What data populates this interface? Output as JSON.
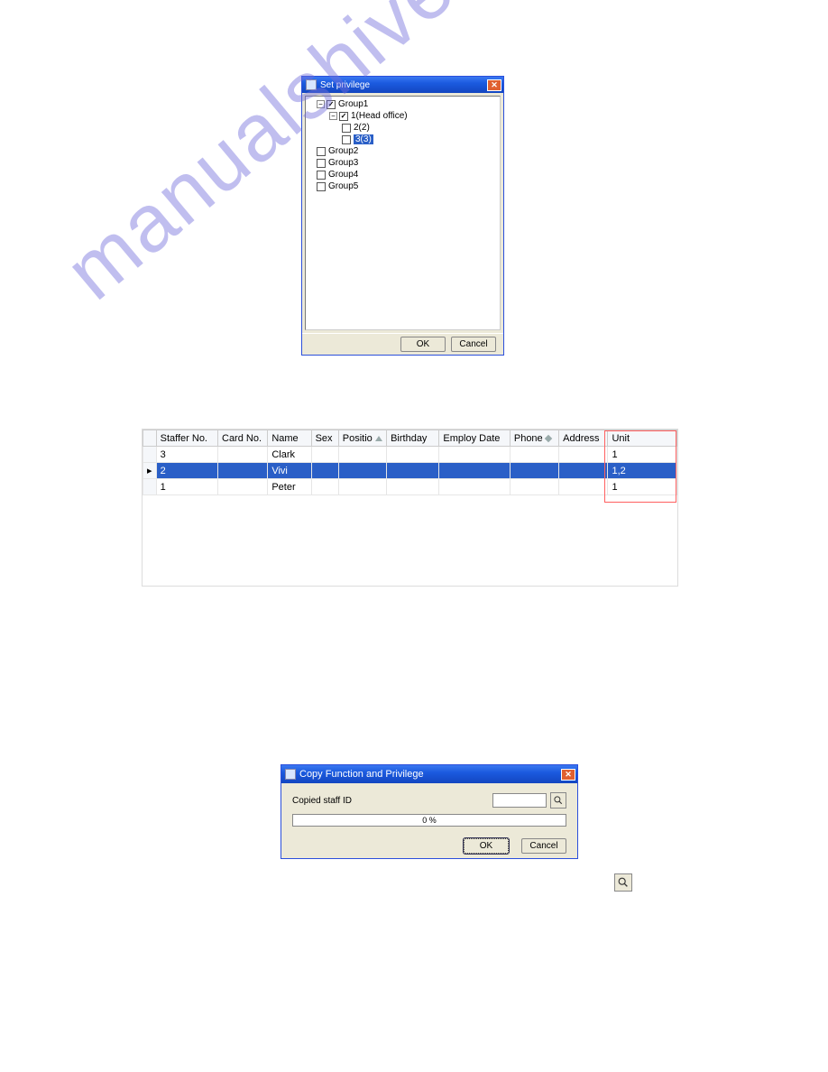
{
  "watermark": "manualshive.com",
  "dialog1": {
    "title": "Set privilege",
    "ok": "OK",
    "cancel": "Cancel",
    "tree": {
      "group1": "Group1",
      "item1": "1(Head office)",
      "item2": "2(2)",
      "item3": "3(3)",
      "group2": "Group2",
      "group3": "Group3",
      "group4": "Group4",
      "group5": "Group5"
    }
  },
  "table": {
    "headers": {
      "staffer": "Staffer No.",
      "card": "Card No.",
      "name": "Name",
      "sex": "Sex",
      "position": "Positio",
      "birthday": "Birthday",
      "employ": "Employ Date",
      "phone": "Phone",
      "address": "Address",
      "unit": "Unit"
    },
    "rows": [
      {
        "ptr": "",
        "staffer": "3",
        "card": "",
        "name": "Clark",
        "sex": "",
        "position": "",
        "birthday": "",
        "employ": "",
        "phone": "",
        "address": "",
        "unit": "1"
      },
      {
        "ptr": "▸",
        "staffer": "2",
        "card": "",
        "name": "Vivi",
        "sex": "",
        "position": "",
        "birthday": "",
        "employ": "",
        "phone": "",
        "address": "",
        "unit": "1,2"
      },
      {
        "ptr": "",
        "staffer": "1",
        "card": "",
        "name": "Peter",
        "sex": "",
        "position": "",
        "birthday": "",
        "employ": "",
        "phone": "",
        "address": "",
        "unit": "1"
      }
    ]
  },
  "dialog2": {
    "title": "Copy Function and Privilege",
    "label": "Copied staff ID",
    "progress": "0 %",
    "ok": "OK",
    "cancel": "Cancel",
    "input_value": ""
  }
}
